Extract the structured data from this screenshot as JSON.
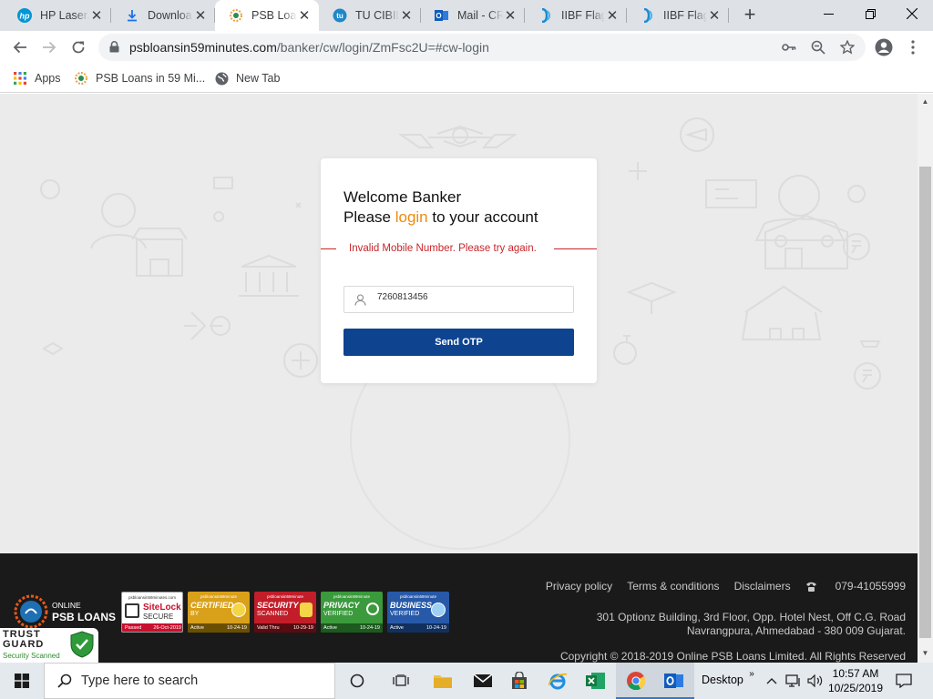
{
  "browser": {
    "tabs": [
      {
        "title": "HP LaserJ",
        "icon": "hp-icon",
        "active": false
      },
      {
        "title": "Downloa",
        "icon": "download-icon",
        "active": false
      },
      {
        "title": "PSB Loan",
        "icon": "psb-icon",
        "active": true
      },
      {
        "title": "TU CIBIL",
        "icon": "cibil-icon",
        "active": false
      },
      {
        "title": "Mail - CR",
        "icon": "outlook-icon",
        "active": false
      },
      {
        "title": "IIBF Flags",
        "icon": "iibf-icon",
        "active": false
      },
      {
        "title": "IIBF Flags",
        "icon": "iibf-icon",
        "active": false
      }
    ],
    "url_host": "psbloansin59minutes.com",
    "url_path": "/banker/cw/login/ZmFsc2U=#cw-login",
    "bookmarks": [
      {
        "label": "Apps",
        "icon": "apps-grid-icon"
      },
      {
        "label": "PSB Loans in 59 Mi...",
        "icon": "psb-icon"
      },
      {
        "label": "New Tab",
        "icon": "globe-icon"
      }
    ]
  },
  "login": {
    "welcome": "Welcome Banker",
    "please": "Please",
    "login_word": "login",
    "to_account": "to your account",
    "error": "Invalid Mobile Number. Please try again.",
    "mobile_value": "7260813456",
    "send_otp": "Send OTP",
    "colors": {
      "accent": "#f0890f",
      "button": "#0e4390",
      "error": "#c9252b"
    }
  },
  "footer": {
    "links": [
      "Privacy policy",
      "Terms & conditions",
      "Disclaimers"
    ],
    "phone": "079-41055999",
    "address_line1": "301 Optionz Building, 3rd Floor, Opp. Hotel Nest, Off C.G. Road",
    "address_line2": "Navrangpura, Ahmedabad - 380 009 Gujarat.",
    "copyright": "Copyright © 2018-2019 Online PSB Loans Limited. All Rights Reserved",
    "logo_line1": "ONLINE",
    "logo_line2": "PSB LOANS",
    "badges": [
      {
        "top": "psbloansin59minutes.com",
        "main": "SiteLock",
        "sub": "SECURE",
        "foot": "Passed",
        "date": "26-Oct-2019"
      },
      {
        "top": "psbloansin59minute",
        "main": "CERTIFIED",
        "sub": "BY",
        "foot": "Active",
        "date": "10-24-19"
      },
      {
        "top": "psbloansin59minute",
        "main": "SECURITY",
        "sub": "SCANNED",
        "foot": "Valid Thru",
        "date": "10-29-19"
      },
      {
        "top": "psbloansin59minute",
        "main": "PRIVACY",
        "sub": "VERIFIED",
        "foot": "Active",
        "date": "10-24-19"
      },
      {
        "top": "psbloansin59minute",
        "main": "BUSINESS",
        "sub": "VERIFIED",
        "foot": "Active",
        "date": "10-24-19"
      }
    ],
    "trust_line1": "TRUST",
    "trust_line2": "GUARD",
    "trust_sub": "Security Scanned"
  },
  "taskbar": {
    "search_placeholder": "Type here to search",
    "desktop_label": "Desktop",
    "time": "10:57 AM",
    "date": "10/25/2019"
  }
}
